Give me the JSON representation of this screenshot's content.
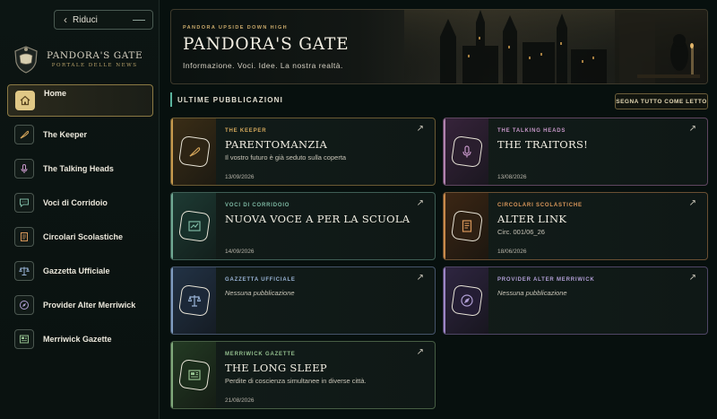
{
  "sidebar": {
    "collapse_label": "Riduci",
    "brand_title": "PANDORA'S GATE",
    "brand_subtitle": "PORTALE DELLE NEWS",
    "items": [
      {
        "label": "Home",
        "icon": "home-icon",
        "active": true
      },
      {
        "label": "The Keeper",
        "icon": "quill-icon"
      },
      {
        "label": "The Talking Heads",
        "icon": "microphone-icon"
      },
      {
        "label": "Voci di Corridoio",
        "icon": "chat-icon"
      },
      {
        "label": "Circolari Scolastiche",
        "icon": "document-icon"
      },
      {
        "label": "Gazzetta Ufficiale",
        "icon": "scales-icon"
      },
      {
        "label": "Provider Alter Merriwick",
        "icon": "compass-icon"
      },
      {
        "label": "Merriwick Gazette",
        "icon": "newspaper-icon"
      }
    ]
  },
  "hero": {
    "pretitle": "PANDORA UPSIDE DOWN HIGH",
    "title": "PANDORA'S GATE",
    "subtitle": "Informazione. Voci. Idee. La nostra realtà."
  },
  "section": {
    "title": "ULTIME PUBBLICAZIONI",
    "mark_all_read": "SEGNA TUTTO COME LETTO"
  },
  "cards": [
    {
      "category": "THE KEEPER",
      "title": "PARENTOMANZIA",
      "desc": "Il vostro futuro è già seduto sulla coperta",
      "date": "13/09/2026",
      "icon": "quill-icon",
      "accent": "#c79a4d"
    },
    {
      "category": "THE TALKING HEADS",
      "title": "THE TRAITORS!",
      "desc": "",
      "date": "13/08/2026",
      "icon": "microphone-icon",
      "accent": "#b283b0"
    },
    {
      "category": "VOCI DI CORRIDOIO",
      "title": "NUOVA VOCE A PER LA SCUOLA",
      "desc": "",
      "date": "14/09/2026",
      "icon": "chart-icon",
      "accent": "#6fa893"
    },
    {
      "category": "CIRCOLARI SCOLASTICHE",
      "title": "ALTER LINK",
      "desc": "Circ. 001/06_26",
      "date": "18/06/2026",
      "icon": "document-icon",
      "accent": "#c98a4a"
    },
    {
      "category": "GAZZETTA UFFICIALE",
      "title": "",
      "desc": "Nessuna pubblicazione",
      "date": "",
      "icon": "scales-icon",
      "accent": "#7f9cc0"
    },
    {
      "category": "PROVIDER ALTER MERRIWICK",
      "title": "",
      "desc": "Nessuna pubblicazione",
      "date": "",
      "icon": "compass-icon",
      "accent": "#9d86c7"
    },
    {
      "category": "MERRIWICK GAZETTE",
      "title": "THE LONG SLEEP",
      "desc": "Perdite di coscienza simultanee in diverse città.",
      "date": "21/08/2026",
      "icon": "newspaper-icon",
      "accent": "#7fa87a"
    }
  ],
  "arrow_glyph": "↗"
}
